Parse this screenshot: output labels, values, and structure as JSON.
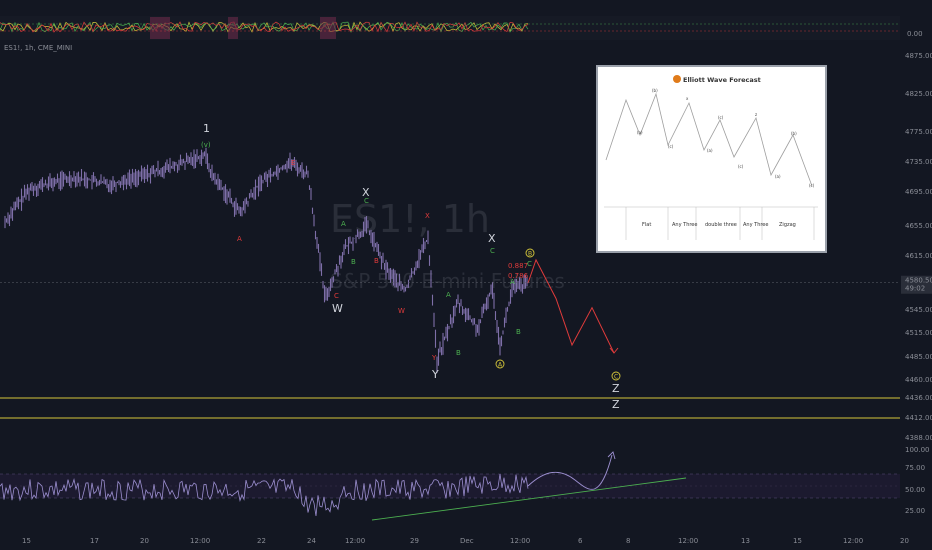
{
  "symbol_line": "ES1!, 1h, CME_MINI",
  "watermark": {
    "title": "ES1!, 1h",
    "subtitle": "S&P 500 E-mini Futures"
  },
  "price_axis": {
    "ticks": [
      "4875.00",
      "4825.00",
      "4775.00",
      "4735.00",
      "4695.00",
      "4655.00",
      "4615.00",
      "4575.00",
      "4545.00",
      "4515.00",
      "4485.00",
      "4460.00",
      "4436.00",
      "4412.00",
      "4388.00"
    ],
    "top_indicator_tick": "0.00",
    "current_price": "4580.50",
    "countdown": "49:02"
  },
  "osc_axis": {
    "ticks": [
      "100.00",
      "75.00",
      "50.00",
      "25.00"
    ]
  },
  "time_axis": {
    "labels": [
      "15",
      "17",
      "20",
      "12:00",
      "22",
      "24",
      "12:00",
      "29",
      "Dec",
      "12:00",
      "6",
      "8",
      "12:00",
      "13",
      "15",
      "12:00",
      "20"
    ]
  },
  "levels": {
    "upper": 4436.0,
    "lower": 4412.0,
    "line_color": "#d4c63a"
  },
  "price_series": {
    "anchors": [
      [
        5,
        4660
      ],
      [
        30,
        4700
      ],
      [
        75,
        4715
      ],
      [
        110,
        4705
      ],
      [
        150,
        4720
      ],
      [
        180,
        4732
      ],
      [
        205,
        4745
      ],
      [
        212,
        4718
      ],
      [
        240,
        4670
      ],
      [
        262,
        4710
      ],
      [
        290,
        4735
      ],
      [
        308,
        4718
      ],
      [
        325,
        4560
      ],
      [
        345,
        4625
      ],
      [
        367,
        4655
      ],
      [
        385,
        4600
      ],
      [
        405,
        4570
      ],
      [
        428,
        4640
      ],
      [
        437,
        4480
      ],
      [
        458,
        4555
      ],
      [
        478,
        4520
      ],
      [
        492,
        4575
      ],
      [
        500,
        4500
      ],
      [
        512,
        4572
      ],
      [
        528,
        4580
      ]
    ],
    "color": "#7e6fa8"
  },
  "forecast_path": {
    "points": [
      [
        528,
        4580
      ],
      [
        536,
        4610
      ],
      [
        556,
        4560
      ],
      [
        572,
        4500
      ],
      [
        592,
        4548
      ],
      [
        614,
        4490
      ]
    ],
    "color": "#e03b3b"
  },
  "fib_labels": [
    "0.887",
    "0.786"
  ],
  "wave_labels": [
    {
      "text": "1",
      "color": "#d1d4dc",
      "size": "big"
    },
    {
      "text": "(v)",
      "color": "#4caf50",
      "size": "small"
    },
    {
      "text": "E",
      "color": "#e03b3b",
      "size": "small"
    },
    {
      "text": "A",
      "color": "#e03b3b",
      "size": "small"
    },
    {
      "text": "X",
      "color": "#d1d4dc",
      "size": "big"
    },
    {
      "text": "C",
      "color": "#4caf50",
      "size": "small"
    },
    {
      "text": "A",
      "color": "#4caf50",
      "size": "small"
    },
    {
      "text": "B",
      "color": "#4caf50",
      "size": "small"
    },
    {
      "text": "C",
      "color": "#e03b3b",
      "size": "small"
    },
    {
      "text": "W",
      "color": "#d1d4dc",
      "size": "big"
    },
    {
      "text": "B",
      "color": "#e03b3b",
      "size": "small"
    },
    {
      "text": "W",
      "color": "#e03b3b",
      "size": "small"
    },
    {
      "text": "X",
      "color": "#e03b3b",
      "size": "small"
    },
    {
      "text": "Y",
      "color": "#e03b3b",
      "size": "small"
    },
    {
      "text": "Y",
      "color": "#d1d4dc",
      "size": "big"
    },
    {
      "text": "A",
      "color": "#4caf50",
      "size": "small"
    },
    {
      "text": "B",
      "color": "#4caf50",
      "size": "small"
    },
    {
      "text": "X",
      "color": "#d1d4dc",
      "size": "big"
    },
    {
      "text": "C",
      "color": "#4caf50",
      "size": "small"
    },
    {
      "text": "A",
      "color": "#4caf50",
      "size": "small"
    },
    {
      "text": "B",
      "color": "#4caf50",
      "size": "small"
    },
    {
      "text": "C",
      "color": "#4caf50",
      "size": "small"
    },
    {
      "text": "Z",
      "color": "#d1d4dc",
      "size": "big"
    },
    {
      "text": "Z",
      "color": "#d1d4dc",
      "size": "big"
    }
  ],
  "circle_labels": [
    "A",
    "B",
    "C"
  ],
  "inset": {
    "title": "Elliott Wave Forecast",
    "boxes": [
      "Flat",
      "Any Three",
      "double three",
      "Any Three",
      "Zigzag"
    ]
  },
  "oscillator": {
    "color": "#9c8fd0",
    "trend_color": "#4caf50"
  }
}
